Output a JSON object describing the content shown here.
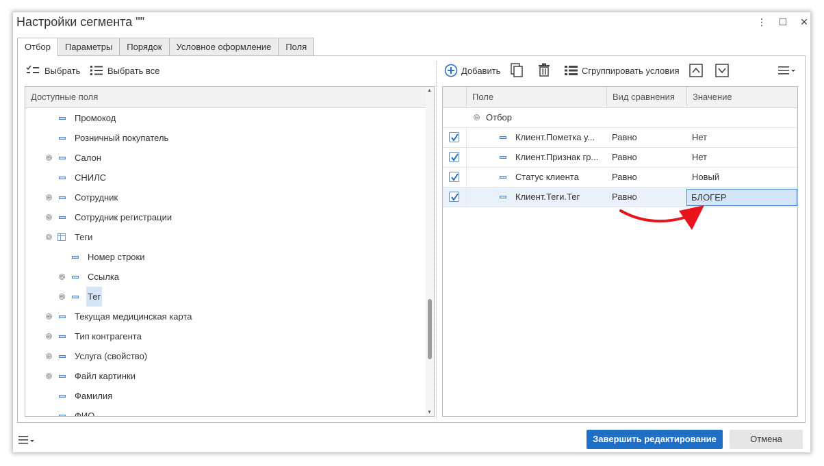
{
  "window": {
    "title": "Настройки сегмента \"\"",
    "controls": {
      "more": "⋮",
      "maximize": "☐",
      "close": "✕"
    }
  },
  "tabs": [
    {
      "label": "Отбор",
      "active": true
    },
    {
      "label": "Параметры",
      "active": false
    },
    {
      "label": "Порядок",
      "active": false
    },
    {
      "label": "Условное оформление",
      "active": false
    },
    {
      "label": "Поля",
      "active": false
    }
  ],
  "left_toolbar": {
    "select_label": "Выбрать",
    "select_all_label": "Выбрать все"
  },
  "tree": {
    "header": "Доступные поля",
    "rows": [
      {
        "label": "Промокод",
        "expander": "",
        "icon": "field",
        "level": 0
      },
      {
        "label": "Розничный покупатель",
        "expander": "",
        "icon": "field",
        "level": 0
      },
      {
        "label": "Салон",
        "expander": "⊕",
        "icon": "field",
        "level": 0
      },
      {
        "label": "СНИЛС",
        "expander": "",
        "icon": "field",
        "level": 0
      },
      {
        "label": "Сотрудник",
        "expander": "⊕",
        "icon": "field",
        "level": 0
      },
      {
        "label": "Сотрудник регистрации",
        "expander": "⊕",
        "icon": "field",
        "level": 0
      },
      {
        "label": "Теги",
        "expander": "⊖",
        "icon": "table",
        "level": 0
      },
      {
        "label": "Номер строки",
        "expander": "",
        "icon": "field",
        "level": 1
      },
      {
        "label": "Ссылка",
        "expander": "⊕",
        "icon": "field",
        "level": 1
      },
      {
        "label": "Тег",
        "expander": "⊕",
        "icon": "field",
        "level": 1,
        "selected": true
      },
      {
        "label": "Текущая медицинская карта",
        "expander": "⊕",
        "icon": "field",
        "level": 0
      },
      {
        "label": "Тип контрагента",
        "expander": "⊕",
        "icon": "field",
        "level": 0
      },
      {
        "label": "Услуга (свойство)",
        "expander": "⊕",
        "icon": "field",
        "level": 0
      },
      {
        "label": "Файл картинки",
        "expander": "⊕",
        "icon": "field",
        "level": 0
      },
      {
        "label": "Фамилия",
        "expander": "",
        "icon": "field",
        "level": 0
      },
      {
        "label": "ФИО",
        "expander": "",
        "icon": "field",
        "level": 0
      }
    ]
  },
  "right_toolbar": {
    "add_label": "Добавить",
    "group_label": "Сгруппировать условия"
  },
  "grid": {
    "columns": [
      "Поле",
      "Вид сравнения",
      "Значение"
    ],
    "group_label": "Отбор",
    "group_expander": "⊖",
    "rows": [
      {
        "checked": true,
        "field": "Клиент.Пометка у...",
        "comparison": "Равно",
        "value": "Нет"
      },
      {
        "checked": true,
        "field": "Клиент.Признак гр...",
        "comparison": "Равно",
        "value": "Нет"
      },
      {
        "checked": true,
        "field": "Статус клиента",
        "comparison": "Равно",
        "value": "Новый"
      },
      {
        "checked": true,
        "field": "Клиент.Теги.Тег",
        "comparison": "Равно",
        "value": "БЛОГЕР",
        "selected": true
      }
    ]
  },
  "footer": {
    "finish_label": "Завершить редактирование",
    "cancel_label": "Отмена"
  },
  "colors": {
    "accent": "#1f6fc7",
    "annotation_arrow": "#e8141b",
    "selection": "#d3e5f8"
  }
}
